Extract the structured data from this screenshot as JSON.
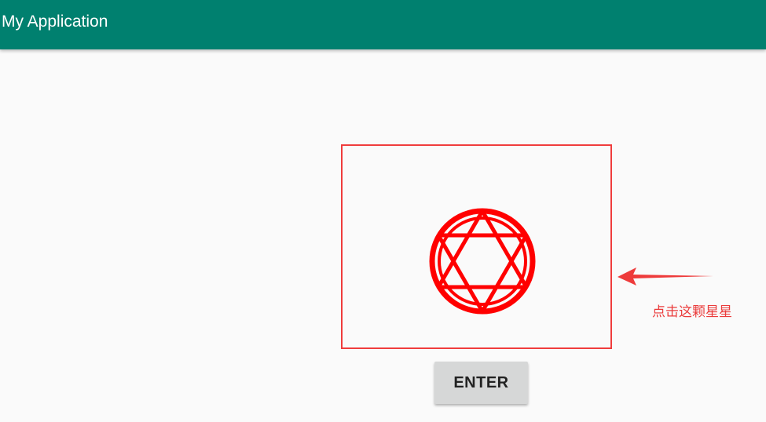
{
  "app_bar": {
    "title": "My Application",
    "background_color": "#00806f"
  },
  "main": {
    "star": {
      "icon": "hexagram-in-circle-icon",
      "color": "#ff0000"
    },
    "highlight_box_color": "#f03c3c",
    "enter_button": {
      "label": "ENTER"
    },
    "annotation": {
      "text": "点击这颗星星",
      "color": "#ea3b3b",
      "icon": "arrow-left-icon"
    }
  }
}
